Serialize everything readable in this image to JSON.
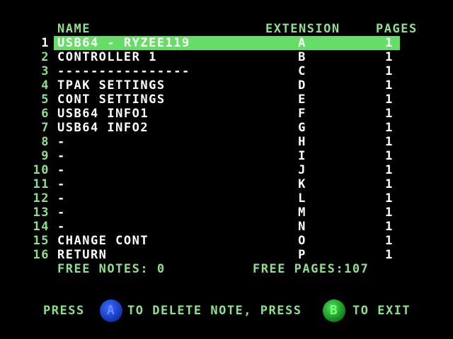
{
  "headers": {
    "name": "NAME",
    "extension": "EXTENSION",
    "pages": "PAGES"
  },
  "notes": [
    {
      "num": "1",
      "name": "USB64 - RYZEE119",
      "ext": "A",
      "pages": "1"
    },
    {
      "num": "2",
      "name": "CONTROLLER 1",
      "ext": "B",
      "pages": "1"
    },
    {
      "num": "3",
      "name": "----------------",
      "ext": "C",
      "pages": "1"
    },
    {
      "num": "4",
      "name": "TPAK SETTINGS",
      "ext": "D",
      "pages": "1"
    },
    {
      "num": "5",
      "name": "CONT SETTINGS",
      "ext": "E",
      "pages": "1"
    },
    {
      "num": "6",
      "name": "USB64 INFO1",
      "ext": "F",
      "pages": "1"
    },
    {
      "num": "7",
      "name": "USB64 INFO2",
      "ext": "G",
      "pages": "1"
    },
    {
      "num": "8",
      "name": "-",
      "ext": "H",
      "pages": "1"
    },
    {
      "num": "9",
      "name": "-",
      "ext": "I",
      "pages": "1"
    },
    {
      "num": "10",
      "name": "-",
      "ext": "J",
      "pages": "1"
    },
    {
      "num": "11",
      "name": "-",
      "ext": "K",
      "pages": "1"
    },
    {
      "num": "12",
      "name": "-",
      "ext": "L",
      "pages": "1"
    },
    {
      "num": "13",
      "name": "-",
      "ext": "M",
      "pages": "1"
    },
    {
      "num": "14",
      "name": "-",
      "ext": "N",
      "pages": "1"
    },
    {
      "num": "15",
      "name": "CHANGE CONT",
      "ext": "O",
      "pages": "1"
    },
    {
      "num": "16",
      "name": "RETURN",
      "ext": "P",
      "pages": "1"
    }
  ],
  "selected_index": 0,
  "footer": {
    "free_notes": "FREE NOTES: 0",
    "free_pages": "FREE PAGES:107"
  },
  "prompt": {
    "press": "PRESS",
    "button_a": "A",
    "to_delete": "TO DELETE NOTE, PRESS",
    "button_b": "B",
    "to_exit": "TO EXIT"
  },
  "colors": {
    "background": "#000000",
    "label_green": "#8ee08e",
    "highlight": "#66dd66",
    "button_a_blue": "#1b3fc4",
    "button_b_green": "#1c9a27"
  }
}
